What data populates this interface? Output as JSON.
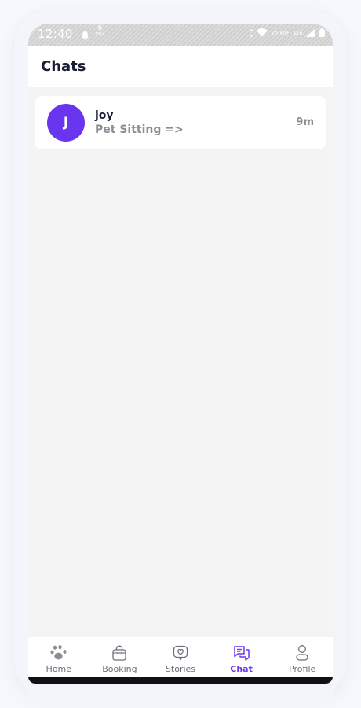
{
  "status_bar": {
    "time": "12:40",
    "net_speed": "6",
    "net_unit": "KB/s",
    "volte": "Vo WiFi",
    "lte": "LTE"
  },
  "header": {
    "title": "Chats"
  },
  "chats": [
    {
      "initial": "J",
      "name": "joy",
      "preview": "Pet Sitting =>",
      "time": "9m",
      "avatar_color": "#6a35ee"
    }
  ],
  "bottom_nav": {
    "items": [
      {
        "label": "Home",
        "icon": "paw-icon",
        "active": false
      },
      {
        "label": "Booking",
        "icon": "bag-icon",
        "active": false
      },
      {
        "label": "Stories",
        "icon": "heart-chat-icon",
        "active": false
      },
      {
        "label": "Chat",
        "icon": "chat-icon",
        "active": true
      },
      {
        "label": "Profile",
        "icon": "profile-icon",
        "active": false
      }
    ]
  },
  "colors": {
    "accent": "#6a35ee",
    "title_text": "#1b1d36",
    "muted_text": "#8b8d94"
  }
}
